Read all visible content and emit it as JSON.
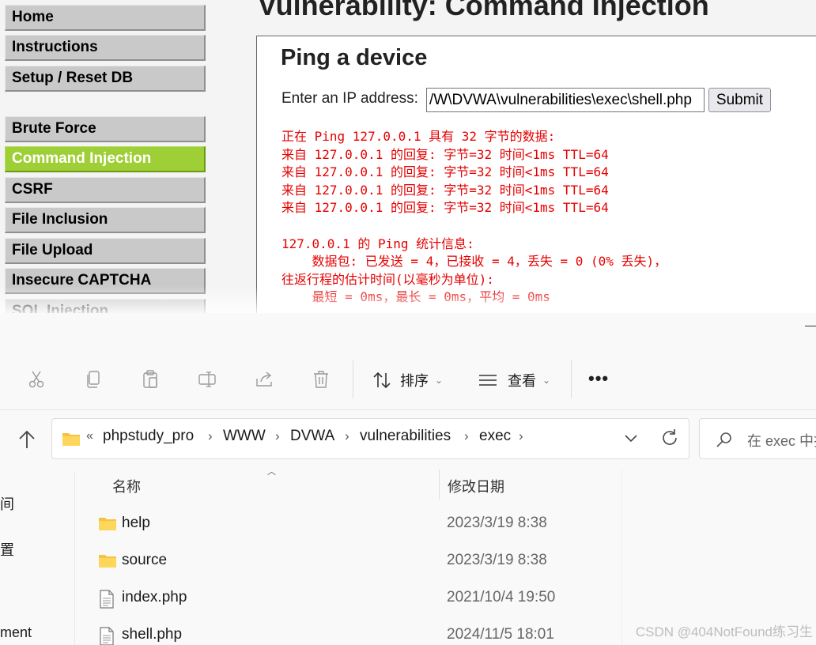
{
  "dvwa": {
    "menu": [
      {
        "label": "Home",
        "active": false
      },
      {
        "label": "Instructions",
        "active": false
      },
      {
        "label": "Setup / Reset DB",
        "active": false
      },
      {
        "label": "Brute Force",
        "active": false
      },
      {
        "label": "Command Injection",
        "active": true
      },
      {
        "label": "CSRF",
        "active": false
      },
      {
        "label": "File Inclusion",
        "active": false
      },
      {
        "label": "File Upload",
        "active": false
      },
      {
        "label": "Insecure CAPTCHA",
        "active": false
      },
      {
        "label": "SQL Injection",
        "active": false
      }
    ],
    "page_title": "Vulnerability: Command Injection",
    "form_heading": "Ping a device",
    "ip_label": "Enter an IP address:",
    "ip_value": "/W\\DVWA\\vulnerabilities\\exec\\shell.php",
    "submit_label": "Submit",
    "output_lines": [
      "正在 Ping 127.0.0.1 具有 32 字节的数据:",
      "来自 127.0.0.1 的回复: 字节=32 时间<1ms TTL=64",
      "来自 127.0.0.1 的回复: 字节=32 时间<1ms TTL=64",
      "来自 127.0.0.1 的回复: 字节=32 时间<1ms TTL=64",
      "来自 127.0.0.1 的回复: 字节=32 时间<1ms TTL=64",
      "",
      "127.0.0.1 的 Ping 统计信息:",
      "    数据包: 已发送 = 4，已接收 = 4，丢失 = 0 (0% 丢失)，",
      "往返行程的估计时间(以毫秒为单位):",
      "    最短 = 0ms，最长 = 0ms，平均 = 0ms"
    ],
    "colors": {
      "active_menu": "#9fcf36",
      "output": "#e60000"
    }
  },
  "explorer": {
    "toolbar": {
      "icons": [
        "cut-icon",
        "copy-icon",
        "paste-icon",
        "rename-icon",
        "share-icon",
        "delete-icon"
      ],
      "sort_label": "排序",
      "view_label": "查看",
      "more_label": "•••"
    },
    "address": {
      "overflow": "«",
      "crumbs": [
        "phpstudy_pro",
        "WWW",
        "DVWA",
        "vulnerabilities",
        "exec"
      ],
      "separator": "›"
    },
    "search_placeholder": "在 exec 中搜",
    "nav_fragments": [
      "间",
      "置",
      "ment"
    ],
    "columns": {
      "name": "名称",
      "date": "修改日期"
    },
    "files": [
      {
        "name": "help",
        "date": "2023/3/19 8:38",
        "type": "folder"
      },
      {
        "name": "source",
        "date": "2023/3/19 8:38",
        "type": "folder"
      },
      {
        "name": "index.php",
        "date": "2021/10/4 19:50",
        "type": "file"
      },
      {
        "name": "shell.php",
        "date": "2024/11/5 18:01",
        "type": "file"
      }
    ]
  },
  "watermark": "CSDN @404NotFound练习生"
}
